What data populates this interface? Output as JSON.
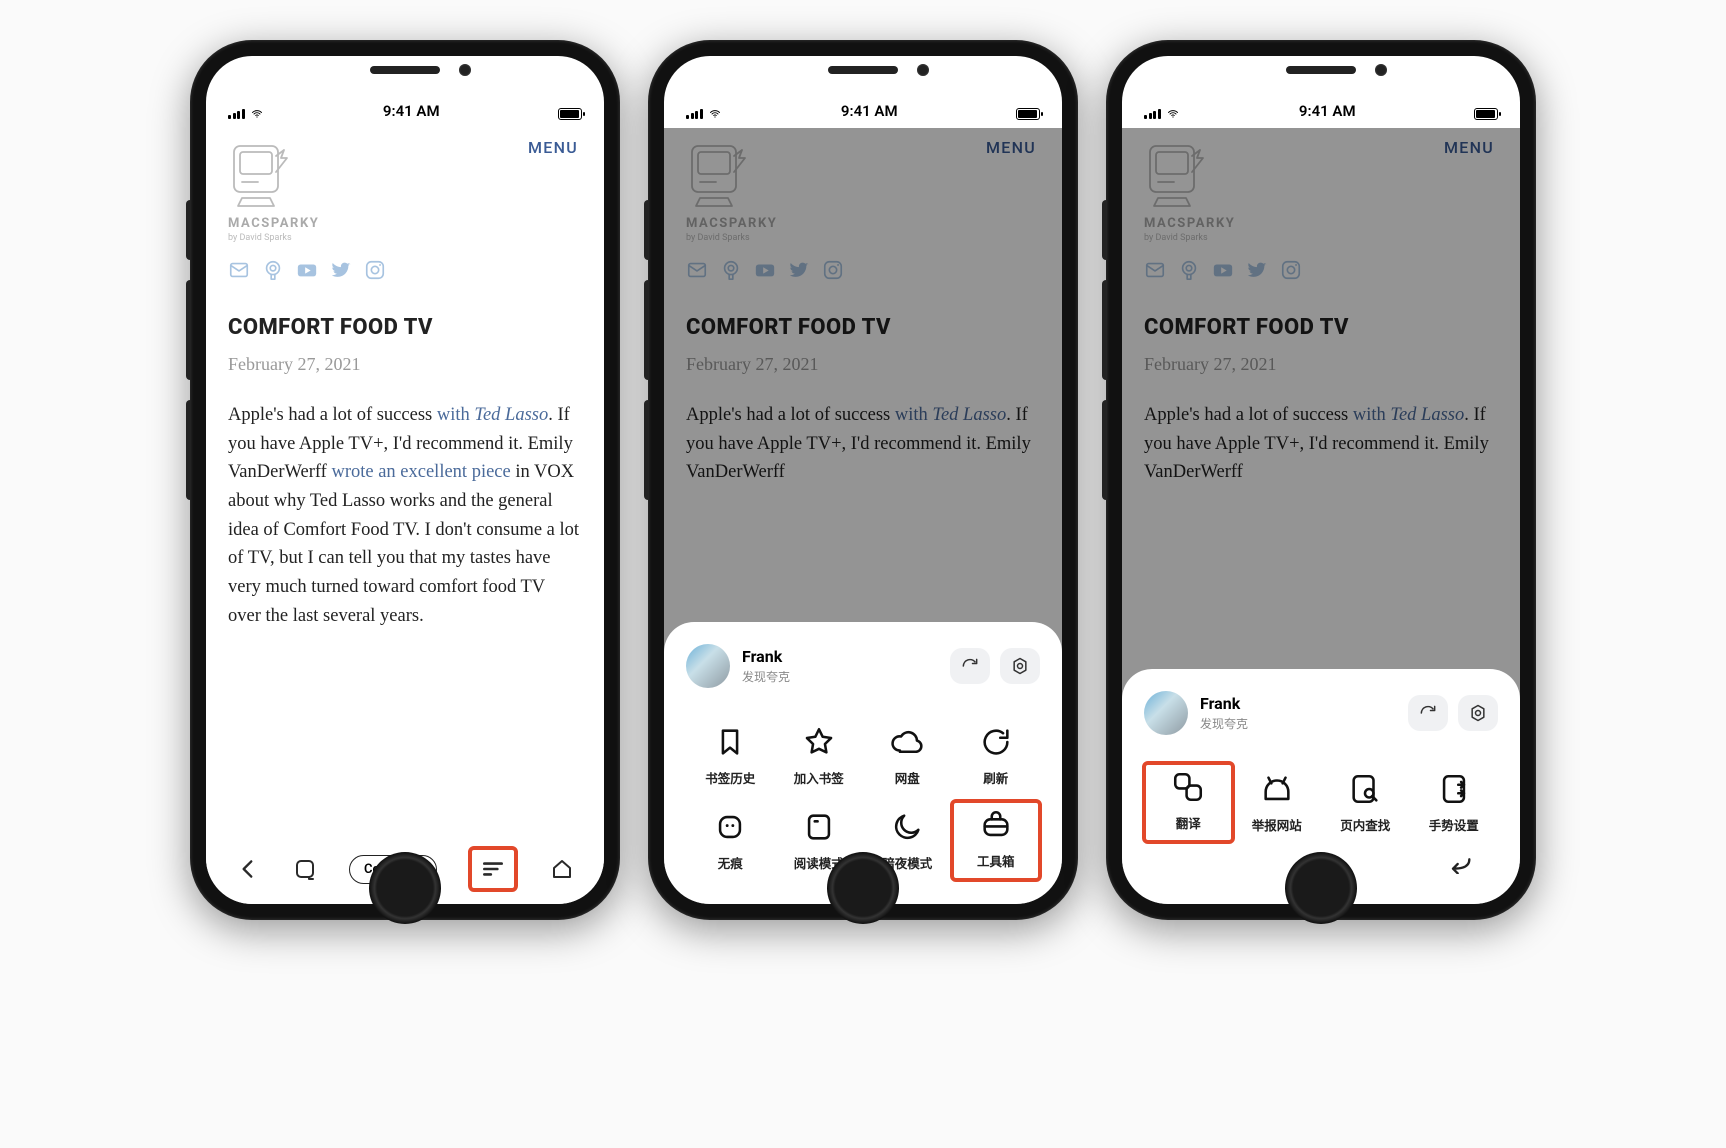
{
  "status": {
    "time": "9:41 AM"
  },
  "site": {
    "menu_label": "MENU",
    "brand": "MACSPARKY",
    "byline": "by David Sparks"
  },
  "article": {
    "title": "COMFORT FOOD TV",
    "date": "February 27, 2021",
    "body_pre": "Apple's had a lot of success ",
    "link1": "with ",
    "link1_em": "Ted Lasso",
    "body_mid1": ". If you have Apple TV+, I'd recommend it. Emily VanDerWerff ",
    "link2": "wrote an excellent piece",
    "body_post": " in VOX about why Ted Lasso works and the general idea of Comfort Food TV. I don't consume a lot of TV, but I can tell you that my tastes have very much turned toward comfort food TV over the last several years."
  },
  "toolbar": {
    "omnibox_text": "Comfort…"
  },
  "sheet": {
    "profile_name": "Frank",
    "profile_sub": "发现夸克",
    "page2": {
      "items": [
        {
          "label": "书签历史"
        },
        {
          "label": "加入书签"
        },
        {
          "label": "网盘"
        },
        {
          "label": "刷新"
        },
        {
          "label": "无痕"
        },
        {
          "label": "阅读模式"
        },
        {
          "label": "暗夜模式"
        },
        {
          "label": "工具箱"
        }
      ],
      "highlight_index": 7
    },
    "page3": {
      "items": [
        {
          "label": "翻译"
        },
        {
          "label": "举报网站"
        },
        {
          "label": "页内查找"
        },
        {
          "label": "手势设置"
        }
      ],
      "highlight_index": 0
    }
  }
}
